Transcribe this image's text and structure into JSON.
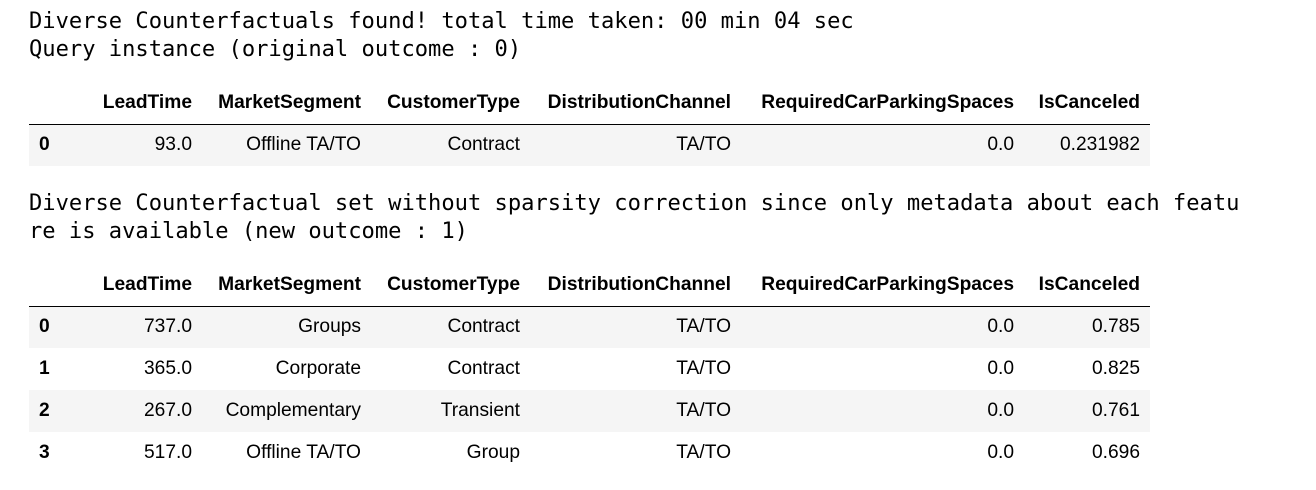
{
  "output": {
    "status_line": "Diverse Counterfactuals found! total time taken: 00 min 04 sec",
    "query_line": "Query instance (original outcome : 0)",
    "cf_line_1": "Diverse Counterfactual set without sparsity correction since only metadata about each featu",
    "cf_line_2": "re is available (new outcome : 1)"
  },
  "query_table": {
    "columns": [
      "",
      "LeadTime",
      "MarketSegment",
      "CustomerType",
      "DistributionChannel",
      "RequiredCarParkingSpaces",
      "IsCanceled"
    ],
    "rows": [
      [
        "0",
        "93.0",
        "Offline TA/TO",
        "Contract",
        "TA/TO",
        "0.0",
        "0.231982"
      ]
    ]
  },
  "cf_table": {
    "columns": [
      "",
      "LeadTime",
      "MarketSegment",
      "CustomerType",
      "DistributionChannel",
      "RequiredCarParkingSpaces",
      "IsCanceled"
    ],
    "rows": [
      [
        "0",
        "737.0",
        "Groups",
        "Contract",
        "TA/TO",
        "0.0",
        "0.785"
      ],
      [
        "1",
        "365.0",
        "Corporate",
        "Contract",
        "TA/TO",
        "0.0",
        "0.825"
      ],
      [
        "2",
        "267.0",
        "Complementary",
        "Transient",
        "TA/TO",
        "0.0",
        "0.761"
      ],
      [
        "3",
        "517.0",
        "Offline TA/TO",
        "Group",
        "TA/TO",
        "0.0",
        "0.696"
      ]
    ]
  }
}
